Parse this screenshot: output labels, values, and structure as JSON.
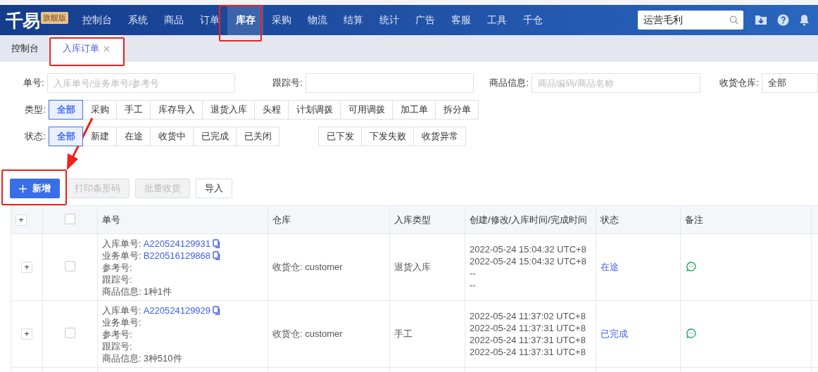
{
  "brand": {
    "logo": "千易",
    "edition": "旗舰版"
  },
  "nav": [
    {
      "label": "控制台",
      "selected": false
    },
    {
      "label": "系统",
      "selected": false
    },
    {
      "label": "商品",
      "selected": false
    },
    {
      "label": "订单",
      "selected": false
    },
    {
      "label": "库存",
      "selected": true
    },
    {
      "label": "采购",
      "selected": false
    },
    {
      "label": "物流",
      "selected": false
    },
    {
      "label": "结算",
      "selected": false
    },
    {
      "label": "统计",
      "selected": false
    },
    {
      "label": "广告",
      "selected": false
    },
    {
      "label": "客服",
      "selected": false
    },
    {
      "label": "工具",
      "selected": false
    },
    {
      "label": "千仓",
      "selected": false
    }
  ],
  "search": {
    "value": "运营毛利"
  },
  "page_tabs": [
    {
      "label": "控制台",
      "selected": false,
      "closable": false
    },
    {
      "label": "入库订单",
      "selected": true,
      "closable": true
    }
  ],
  "filters": [
    {
      "label": "单号:",
      "placeholder": "入库单号/业务单号/参考号",
      "kind": "input"
    },
    {
      "label": "跟踪号:",
      "kind": "input"
    },
    {
      "label": "商品信息:",
      "placeholder": "商品编码/商品名称",
      "kind": "input"
    },
    {
      "label": "收货仓库:",
      "value": "全部",
      "kind": "select"
    }
  ],
  "type_filter": {
    "label": "类型:",
    "options": [
      {
        "label": "全部",
        "selected": true
      },
      {
        "label": "采购",
        "selected": false
      },
      {
        "label": "手工",
        "selected": false
      },
      {
        "label": "库存导入",
        "selected": false
      },
      {
        "label": "退货入库",
        "selected": false
      },
      {
        "label": "头程",
        "selected": false
      },
      {
        "label": "计划调拨",
        "selected": false
      },
      {
        "label": "可用调拨",
        "selected": false
      },
      {
        "label": "加工单",
        "selected": false
      },
      {
        "label": "拆分单",
        "selected": false
      }
    ]
  },
  "status_filter": {
    "label": "状态:",
    "options": [
      {
        "label": "全部",
        "selected": true
      },
      {
        "label": "新建",
        "selected": false
      },
      {
        "label": "在途",
        "selected": false
      },
      {
        "label": "收货中",
        "selected": false
      },
      {
        "label": "已完成",
        "selected": false
      },
      {
        "label": "已关闭",
        "selected": false
      }
    ],
    "extra_options": [
      {
        "label": "已下发",
        "selected": false
      },
      {
        "label": "下发失败",
        "selected": false
      },
      {
        "label": "收货异常",
        "selected": false
      }
    ]
  },
  "actions": [
    {
      "label": "新增",
      "kind": "primary",
      "disabled": false
    },
    {
      "label": "打印条形码",
      "kind": "default",
      "disabled": true
    },
    {
      "label": "批量收货",
      "kind": "default",
      "disabled": true
    },
    {
      "label": "导入",
      "kind": "default",
      "disabled": false
    }
  ],
  "table": {
    "expand_all": "+",
    "header_checked": false,
    "columns": [
      "单号",
      "仓库",
      "入库类型",
      "创建/修改/入库时间/完成时间",
      "状态",
      "备注"
    ],
    "rows": [
      {
        "expand": "+",
        "checked": false,
        "numbers": [
          {
            "label": "入库单号:",
            "value": "A220524129931",
            "copy": true
          },
          {
            "label": "业务单号:",
            "value": "B220516129868",
            "copy": true
          },
          {
            "label": "参考号:"
          },
          {
            "label": "跟踪号:"
          },
          {
            "label": "商品信息:",
            "value": "1种1件",
            "copy": false
          }
        ],
        "warehouse": "收货仓: customer",
        "type": "退货入库",
        "times": [
          "2022-05-24 15:04:32 UTC+8",
          "2022-05-24 15:04:32 UTC+8",
          "--",
          "--"
        ],
        "status": "在途",
        "has_remark": true
      },
      {
        "expand": "+",
        "checked": false,
        "numbers": [
          {
            "label": "入库单号:",
            "value": "A220524129929",
            "copy": true
          },
          {
            "label": "业务单号:"
          },
          {
            "label": "参考号:"
          },
          {
            "label": "跟踪号:"
          },
          {
            "label": "商品信息:",
            "value": "3种510件",
            "copy": false
          }
        ],
        "warehouse": "收货仓: customer",
        "type": "手工",
        "times": [
          "2022-05-24 11:37:02 UTC+8",
          "2022-05-24 11:37:31 UTC+8",
          "2022-05-24 11:37:31 UTC+8",
          "2022-05-24 11:37:31 UTC+8"
        ],
        "status": "已完成",
        "has_remark": true
      }
    ]
  }
}
